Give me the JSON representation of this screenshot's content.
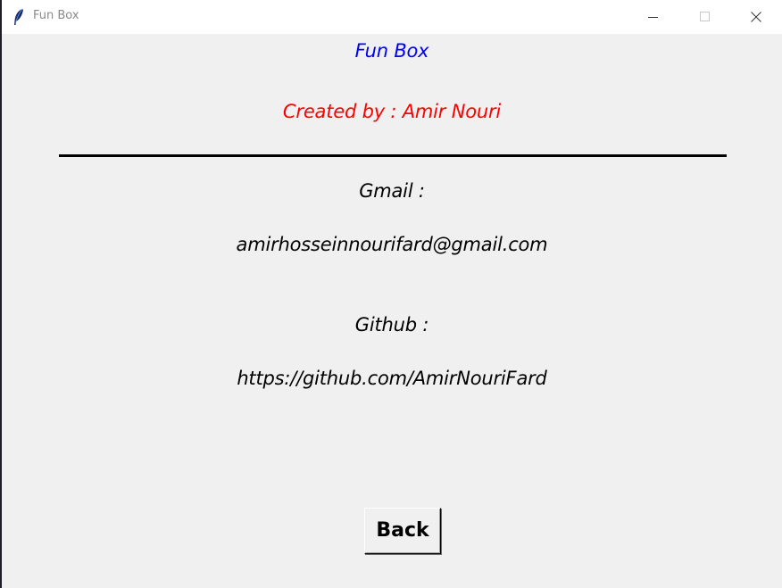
{
  "window": {
    "title": "Fun Box",
    "controls": {
      "minimize": "minimize-icon",
      "maximize": "maximize-icon",
      "close": "close-icon"
    }
  },
  "content": {
    "app_title": "Fun Box",
    "author": "Created by : Amir Nouri",
    "gmail_label": "Gmail :",
    "gmail_value": "amirhosseinnourifard@gmail.com",
    "github_label": "Github :",
    "github_value": "https://github.com/AmirNouriFard",
    "back_button": "Back"
  },
  "colors": {
    "app_title": "#0000ff",
    "author": "#ff0000",
    "text": "#000000",
    "background": "#f0f0f0"
  }
}
